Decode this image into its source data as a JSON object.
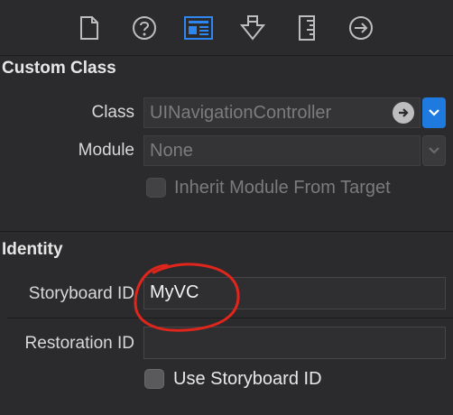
{
  "toolbar": {
    "icons": [
      {
        "name": "file-inspector-icon",
        "selected": false
      },
      {
        "name": "help-inspector-icon",
        "selected": false
      },
      {
        "name": "identity-inspector-icon",
        "selected": true
      },
      {
        "name": "attributes-inspector-icon",
        "selected": false
      },
      {
        "name": "size-inspector-icon",
        "selected": false
      },
      {
        "name": "connections-inspector-icon",
        "selected": false
      }
    ],
    "accent_color": "#2e86f0"
  },
  "custom_class": {
    "header": "Custom Class",
    "class_label": "Class",
    "class_value": "UINavigationController",
    "module_label": "Module",
    "module_value": "None",
    "inherit_label": "Inherit Module From Target",
    "inherit_checked": false
  },
  "identity": {
    "header": "Identity",
    "storyboard_id_label": "Storyboard ID",
    "storyboard_id_value": "MyVC",
    "restoration_id_label": "Restoration ID",
    "restoration_id_value": "",
    "use_storyboard_id_label": "Use Storyboard ID",
    "use_storyboard_id_checked": false
  },
  "annotation_color": "#e0261c"
}
